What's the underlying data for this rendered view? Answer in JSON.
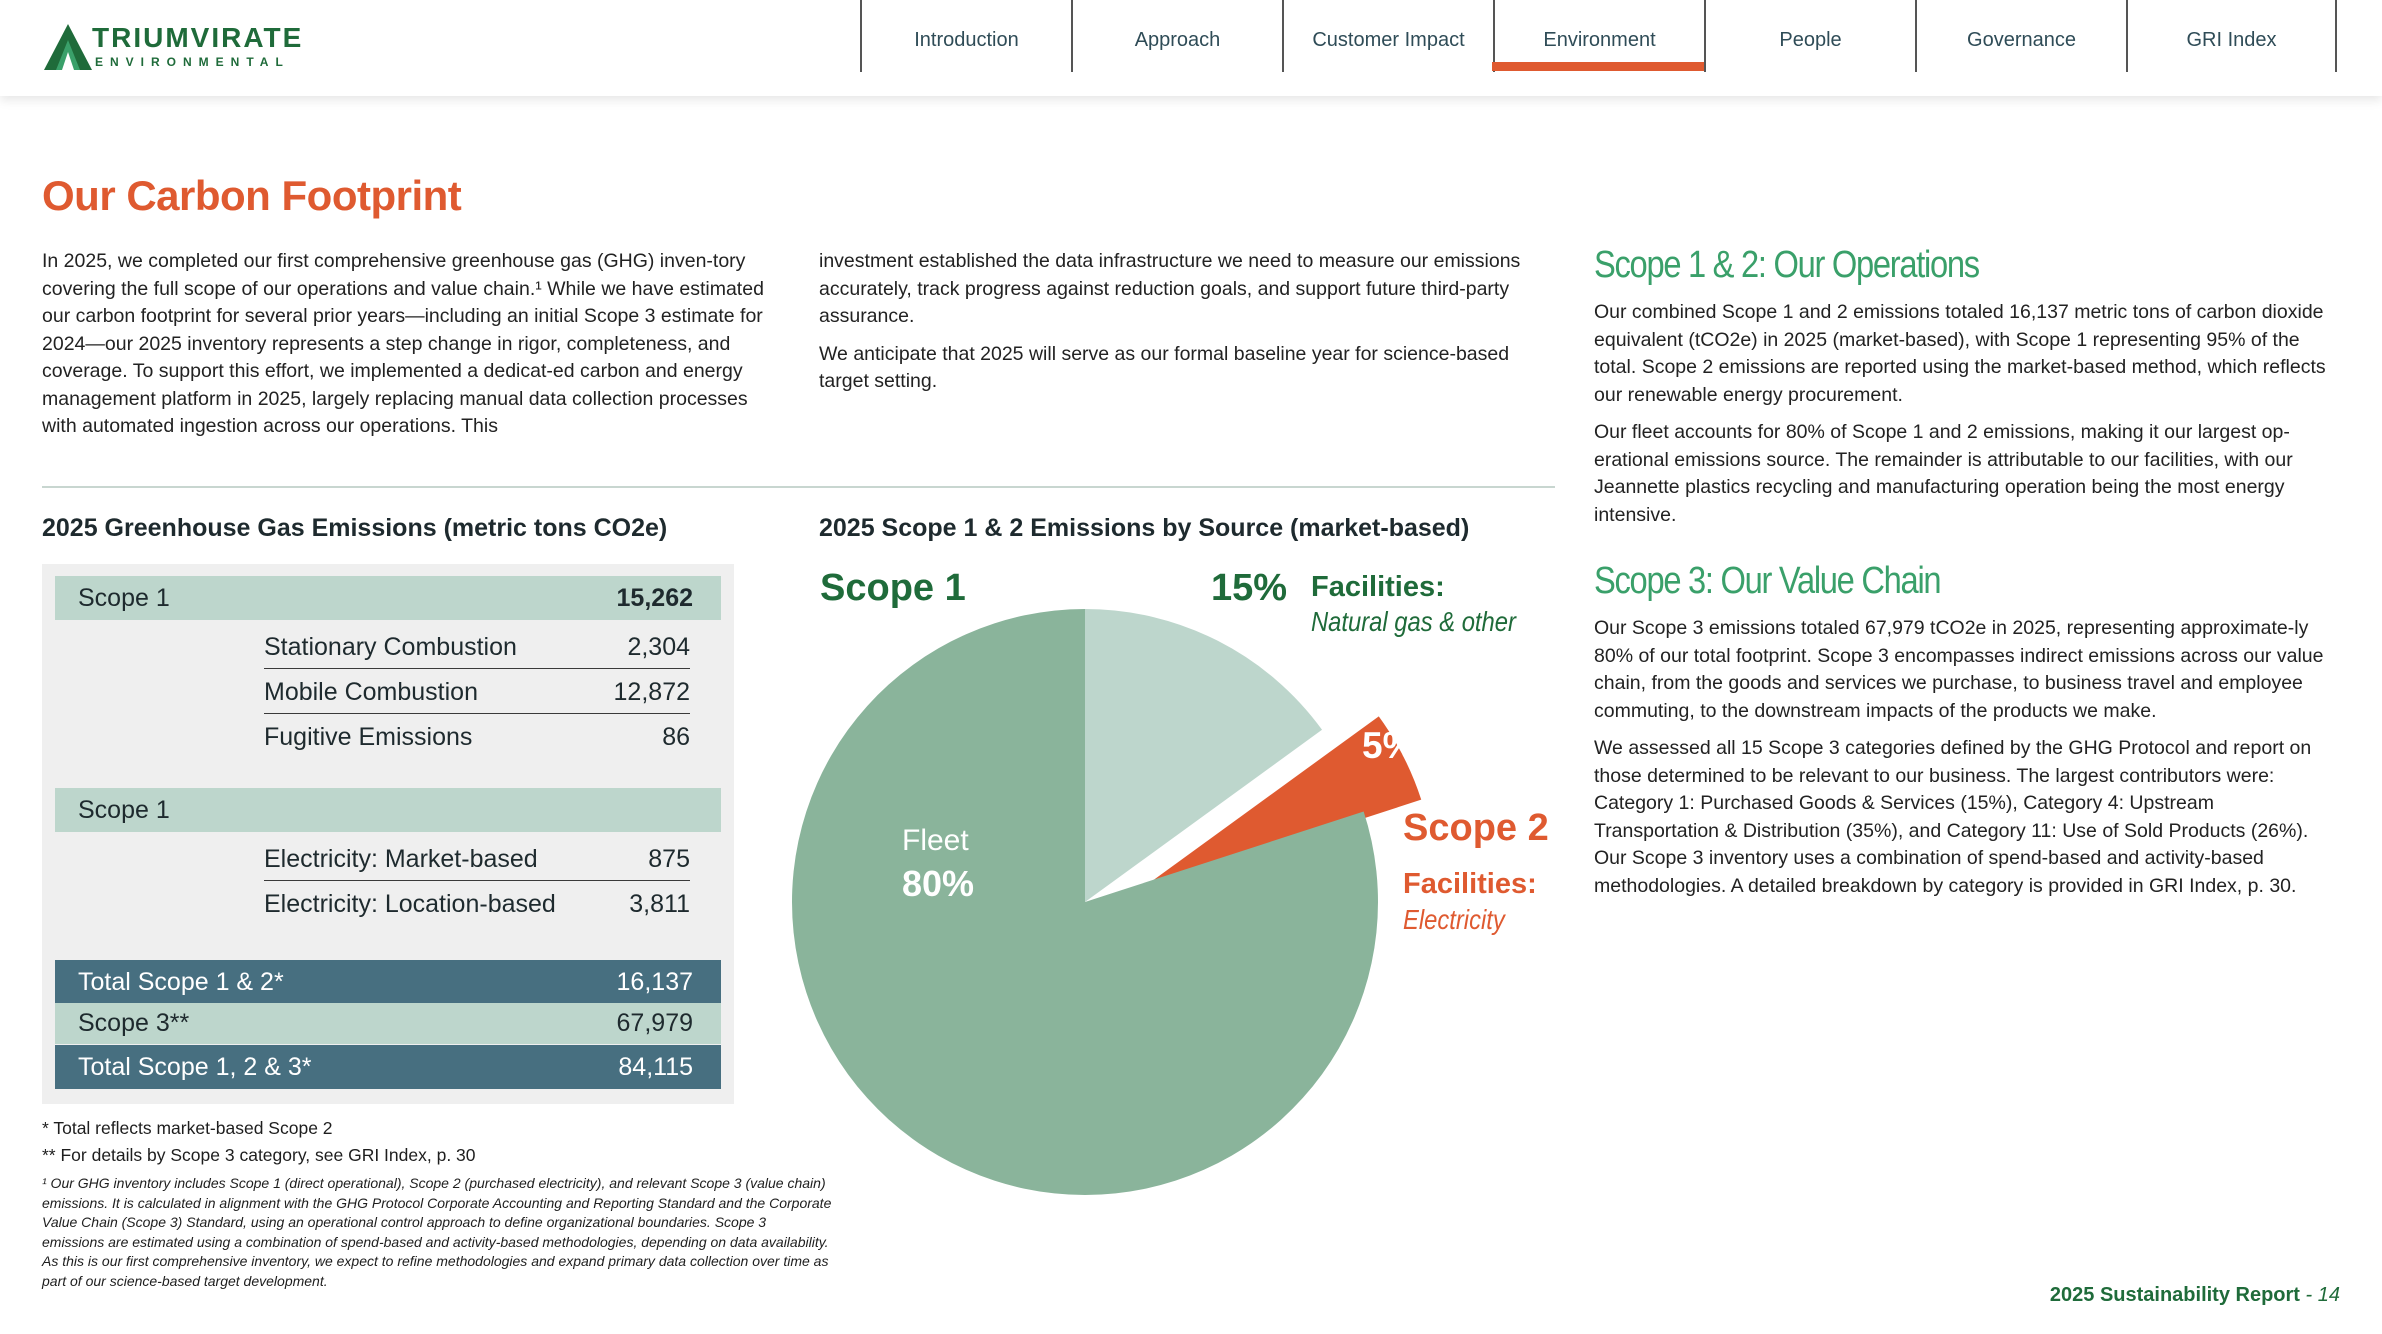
{
  "brand": {
    "name": "TRIUMVIRATE",
    "sub": "ENVIRONMENTAL",
    "color": "#1f6b3a",
    "accent": "#df5a30"
  },
  "nav": {
    "items": [
      "Introduction",
      "Approach",
      "Customer Impact",
      "Environment",
      "People",
      "Governance",
      "GRI Index"
    ],
    "active": "Environment"
  },
  "title": "Our Carbon Footprint",
  "intro": {
    "col1": "In 2025, we completed our first comprehensive greenhouse gas (GHG) inven-tory covering the full scope of our operations and value chain.¹ While we have estimated our carbon footprint for several prior years—including an initial Scope 3 estimate for 2024—our 2025 inventory represents a step change in rigor, completeness, and coverage. To support this effort, we implemented a dedicat-ed carbon and energy management platform in 2025, largely replacing manual data collection processes with automated ingestion across our operations. This",
    "col2_p1": "investment established the data infrastructure we need to measure our emissions accurately, track progress against reduction goals, and support future third-party assurance.",
    "col2_p2": "We anticipate that 2025 will serve as our formal baseline year for science-based target setting."
  },
  "side": {
    "head1": "Scope 1 & 2: Our Operations",
    "p1": "Our combined Scope 1 and 2 emissions totaled 16,137 metric tons of carbon dioxide equivalent (tCO2e) in 2025 (market-based), with Scope 1 representing 95% of the total. Scope 2 emissions are reported using the market-based method, which reflects our renewable energy procurement.",
    "p2": "Our fleet accounts for 80% of Scope 1 and 2 emissions, making it our largest op-erational emissions source. The remainder is attributable to our facilities, with our Jeannette plastics recycling and manufacturing operation being the most energy intensive.",
    "head2": "Scope 3: Our Value Chain",
    "p3": "Our Scope 3 emissions totaled 67,979 tCO2e in 2025, representing approximate-ly 80% of our total footprint. Scope 3 encompasses indirect emissions across our value chain, from the goods and services we purchase, to business travel and employee commuting, to the downstream impacts of the products we make.",
    "p4": "We assessed all 15 Scope 3 categories defined by the GHG Protocol and report on those determined to be relevant to our business. The largest contributors were: Category 1: Purchased Goods & Services (15%), Category 4: Upstream Transportation & Distribution (35%), and Category 11: Use of Sold Products (26%). Our Scope 3 inventory uses a combination of spend-based and activity-based methodologies. A detailed breakdown by category is provided in GRI Index, p. 30."
  },
  "table": {
    "title": "2025 Greenhouse Gas Emissions (metric tons CO2e)",
    "scope1": {
      "label": "Scope 1",
      "value": "15,262"
    },
    "scope1_rows": [
      {
        "label": "Stationary Combustion",
        "value": "2,304"
      },
      {
        "label": "Mobile Combustion",
        "value": "12,872"
      },
      {
        "label": "Fugitive Emissions",
        "value": "86"
      }
    ],
    "scope2": {
      "label": "Scope 1",
      "value": ""
    },
    "scope2_rows": [
      {
        "label": "Electricity: Market-based",
        "value": "875"
      },
      {
        "label": "Electricity: Location-based",
        "value": "3,811"
      }
    ],
    "totals": [
      {
        "label": "Total Scope 1 & 2*",
        "value": "16,137",
        "style": "dark"
      },
      {
        "label": "Scope 3**",
        "value": "67,979",
        "style": "light"
      },
      {
        "label": "Total Scope 1, 2 & 3*",
        "value": "84,115",
        "style": "dark"
      }
    ],
    "note1": "* Total reflects market-based Scope 2",
    "note2": "** For details by Scope 3 category, see GRI Index, p. 30",
    "footnote": "¹ Our GHG inventory includes Scope 1 (direct operational), Scope 2 (purchased electricity), and relevant Scope 3 (value chain) emissions. It is calculated in alignment with the GHG Protocol Corporate Accounting and Reporting Standard and the Corporate Value Chain (Scope 3) Standard, using an operational control approach to define organizational boundaries. Scope 3 emissions are estimated using a combination of spend-based and activity-based methodologies, depending on data availability. As this is our first comprehensive inventory, we expect to refine methodologies and expand primary data collection over time as part of our science-based target development."
  },
  "chart_data": {
    "type": "pie",
    "title": "2025 Scope 1 & 2 Emissions by Source (market-based)",
    "slices": [
      {
        "name": "Fleet",
        "value": 80,
        "label": "80%",
        "color": "#8ab49b",
        "group": "Scope 1"
      },
      {
        "name": "Facilities: Natural gas & other",
        "value": 15,
        "label": "15%",
        "color": "#bdd6cc",
        "group": "Scope 1"
      },
      {
        "name": "Facilities: Electricity",
        "value": 5,
        "label": "5%",
        "color": "#df5a30",
        "group": "Scope 2"
      }
    ],
    "labels": {
      "scope1": "Scope 1",
      "scope2": "Scope 2",
      "fleet": "Fleet",
      "fleet_pct": "80%",
      "nat_pct": "15%",
      "nat_title": "Facilities:",
      "nat_sub": "Natural gas & other",
      "elec_pct": "5%",
      "elec_title": "Facilities:",
      "elec_sub": "Electricity"
    }
  },
  "footer": {
    "report": "2025 Sustainability Report",
    "page": "- 14"
  }
}
